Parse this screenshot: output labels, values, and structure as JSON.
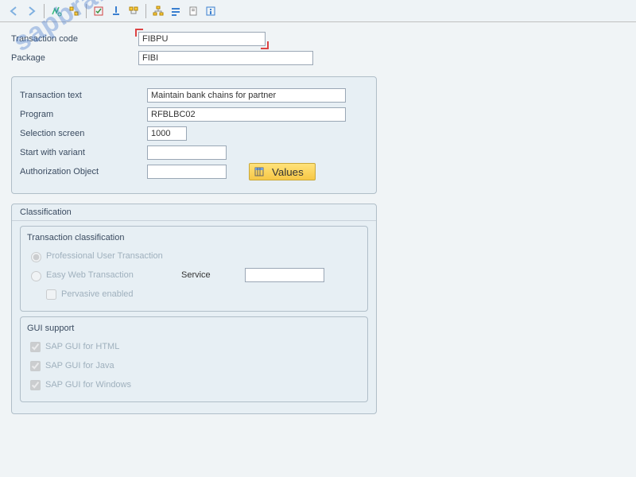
{
  "watermark": "sapbrainsonline.com",
  "header": {
    "transaction_code_label": "Transaction code",
    "transaction_code_value": "FIBPU",
    "package_label": "Package",
    "package_value": "FIBI"
  },
  "details": {
    "transaction_text_label": "Transaction text",
    "transaction_text_value": "Maintain bank chains for partner",
    "program_label": "Program",
    "program_value": "RFBLBC02",
    "selection_screen_label": "Selection screen",
    "selection_screen_value": "1000",
    "start_variant_label": "Start with variant",
    "start_variant_value": "",
    "auth_object_label": "Authorization Object",
    "auth_object_value": "",
    "values_btn": "Values"
  },
  "classification": {
    "title": "Classification",
    "tc_title": "Transaction classification",
    "professional": "Professional User Transaction",
    "easy_web": "Easy Web Transaction",
    "service_label": "Service",
    "service_value": "",
    "pervasive": "Pervasive enabled",
    "gui_title": "GUI support",
    "gui_html": "SAP GUI for HTML",
    "gui_java": "SAP GUI for Java",
    "gui_win": "SAP GUI for Windows"
  }
}
